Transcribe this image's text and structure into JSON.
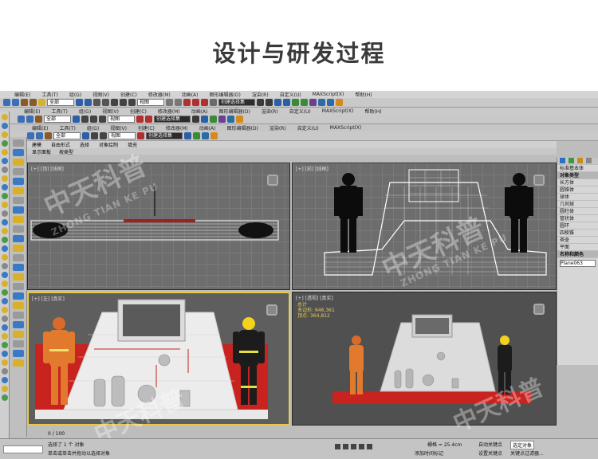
{
  "heading": "设计与研发过程",
  "app": {
    "menu_items": [
      "编辑(E)",
      "工具(T)",
      "组(G)",
      "视图(V)",
      "创建(C)",
      "修改器(M)",
      "动画(A)",
      "图形编辑器(D)",
      "渲染(R)",
      "自定义(U)",
      "MAXScript(X)",
      "帮助(H)"
    ],
    "toolbar_fields": {
      "select_filter": "全部",
      "view_mode": "视图",
      "named_selection": "创建选择集"
    },
    "sub_tabs": [
      "建模",
      "自由形式",
      "选择",
      "对象绘制",
      "填充"
    ],
    "secondary_tabs": [
      "显示面板",
      "按类型"
    ],
    "viewports": [
      {
        "label": "[+] [顶] [线框]",
        "view": "top"
      },
      {
        "label": "[+] [前] [线框]",
        "view": "front"
      },
      {
        "label": "[+] [左] [真实]",
        "view": "left"
      },
      {
        "label": "[+] [透视] [真实]",
        "view": "perspective"
      }
    ],
    "perspective_stats": {
      "header": "总计",
      "polys_label": "多边形:",
      "polys_value": "646,361",
      "verts_label": "顶点:",
      "verts_value": "364,812"
    },
    "right_panel": {
      "dropdown": "标准基本体",
      "section": "对象类型",
      "buttons": [
        "长方体",
        "圆锥体",
        "球体",
        "几何球",
        "圆柱体",
        "管状体",
        "圆环",
        "四棱锥",
        "茶壶",
        "平面"
      ],
      "name_section": "名称和颜色",
      "name_value": "Plane063"
    },
    "status": {
      "selection": "选择了 1 个 对象",
      "prompt": "单击或单击并拖动以选择对象",
      "add_time_tag": "添加时间标记",
      "grid": "栅格 = 25.4cm",
      "auto_key": "自动关键点",
      "set_key": "设置关键点",
      "selected_object": "选定对象",
      "key_filter": "关键点过滤器...",
      "timeline_pos": "0 / 100"
    },
    "watermark": {
      "cn": "中天科普",
      "en": "ZHONG TIAN KE PU"
    }
  }
}
